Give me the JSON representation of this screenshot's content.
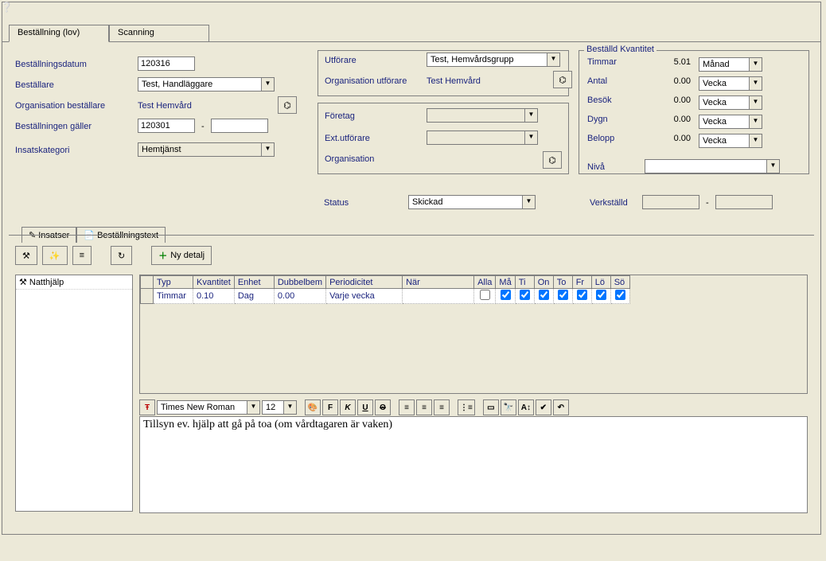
{
  "tabs": {
    "order": "Beställning (lov)",
    "scanning": "Scanning"
  },
  "left": {
    "date_lbl": "Beställningsdatum",
    "date_val": "120316",
    "orderer_lbl": "Beställare",
    "orderer_val": "Test, Handläggare",
    "org_lbl": "Organisation beställare",
    "org_val": "Test Hemvård",
    "applies_lbl": "Beställningen gäller",
    "applies_val1": "120301",
    "applies_val2": "",
    "cat_lbl": "Insatskategori",
    "cat_val": "Hemtjänst"
  },
  "mid": {
    "performer_lbl": "Utförare",
    "performer_val": "Test, Hemvårdsgrupp",
    "org_perf_lbl": "Organisation utförare",
    "org_perf_val": "Test Hemvård",
    "company_lbl": "Företag",
    "company_val": "",
    "ext_lbl": "Ext.utförare",
    "ext_val": "",
    "org2_lbl": "Organisation"
  },
  "quantity": {
    "legend": "Beställd Kvantitet",
    "rows": [
      {
        "lbl": "Timmar",
        "val": "5.01",
        "unit": "Månad"
      },
      {
        "lbl": "Antal",
        "val": "0.00",
        "unit": "Vecka"
      },
      {
        "lbl": "Besök",
        "val": "0.00",
        "unit": "Vecka"
      },
      {
        "lbl": "Dygn",
        "val": "0.00",
        "unit": "Vecka"
      },
      {
        "lbl": "Belopp",
        "val": "0.00",
        "unit": "Vecka"
      }
    ],
    "level_lbl": "Nivå",
    "level_val": ""
  },
  "status": {
    "lbl": "Status",
    "val": "Skickad",
    "executed_lbl": "Verkställd",
    "executed_v1": "",
    "executed_v2": ""
  },
  "subtabs": {
    "insatser": "Insatser",
    "text": "Beställningstext"
  },
  "toolbar": {
    "newdetail": "Ny detalj"
  },
  "tree": {
    "item0": "Natthjälp"
  },
  "grid": {
    "headers": {
      "typ": "Typ",
      "kvant": "Kvantitet",
      "enhet": "Enhet",
      "dubbel": "Dubbelbem",
      "period": "Periodicitet",
      "nar": "När",
      "alla": "Alla",
      "ma": "Må",
      "ti": "Ti",
      "on": "On",
      "to": "To",
      "fr": "Fr",
      "lo": "Lö",
      "so": "Sö"
    },
    "row0": {
      "typ": "Timmar",
      "kvant": "0.10",
      "enhet": "Dag",
      "dubbel": "0.00",
      "period": "Varje vecka",
      "nar": ""
    }
  },
  "editor": {
    "font": "Times New Roman",
    "size": "12",
    "content": "Tillsyn ev. hjälp att gå på toa (om vårdtagaren är vaken)"
  }
}
